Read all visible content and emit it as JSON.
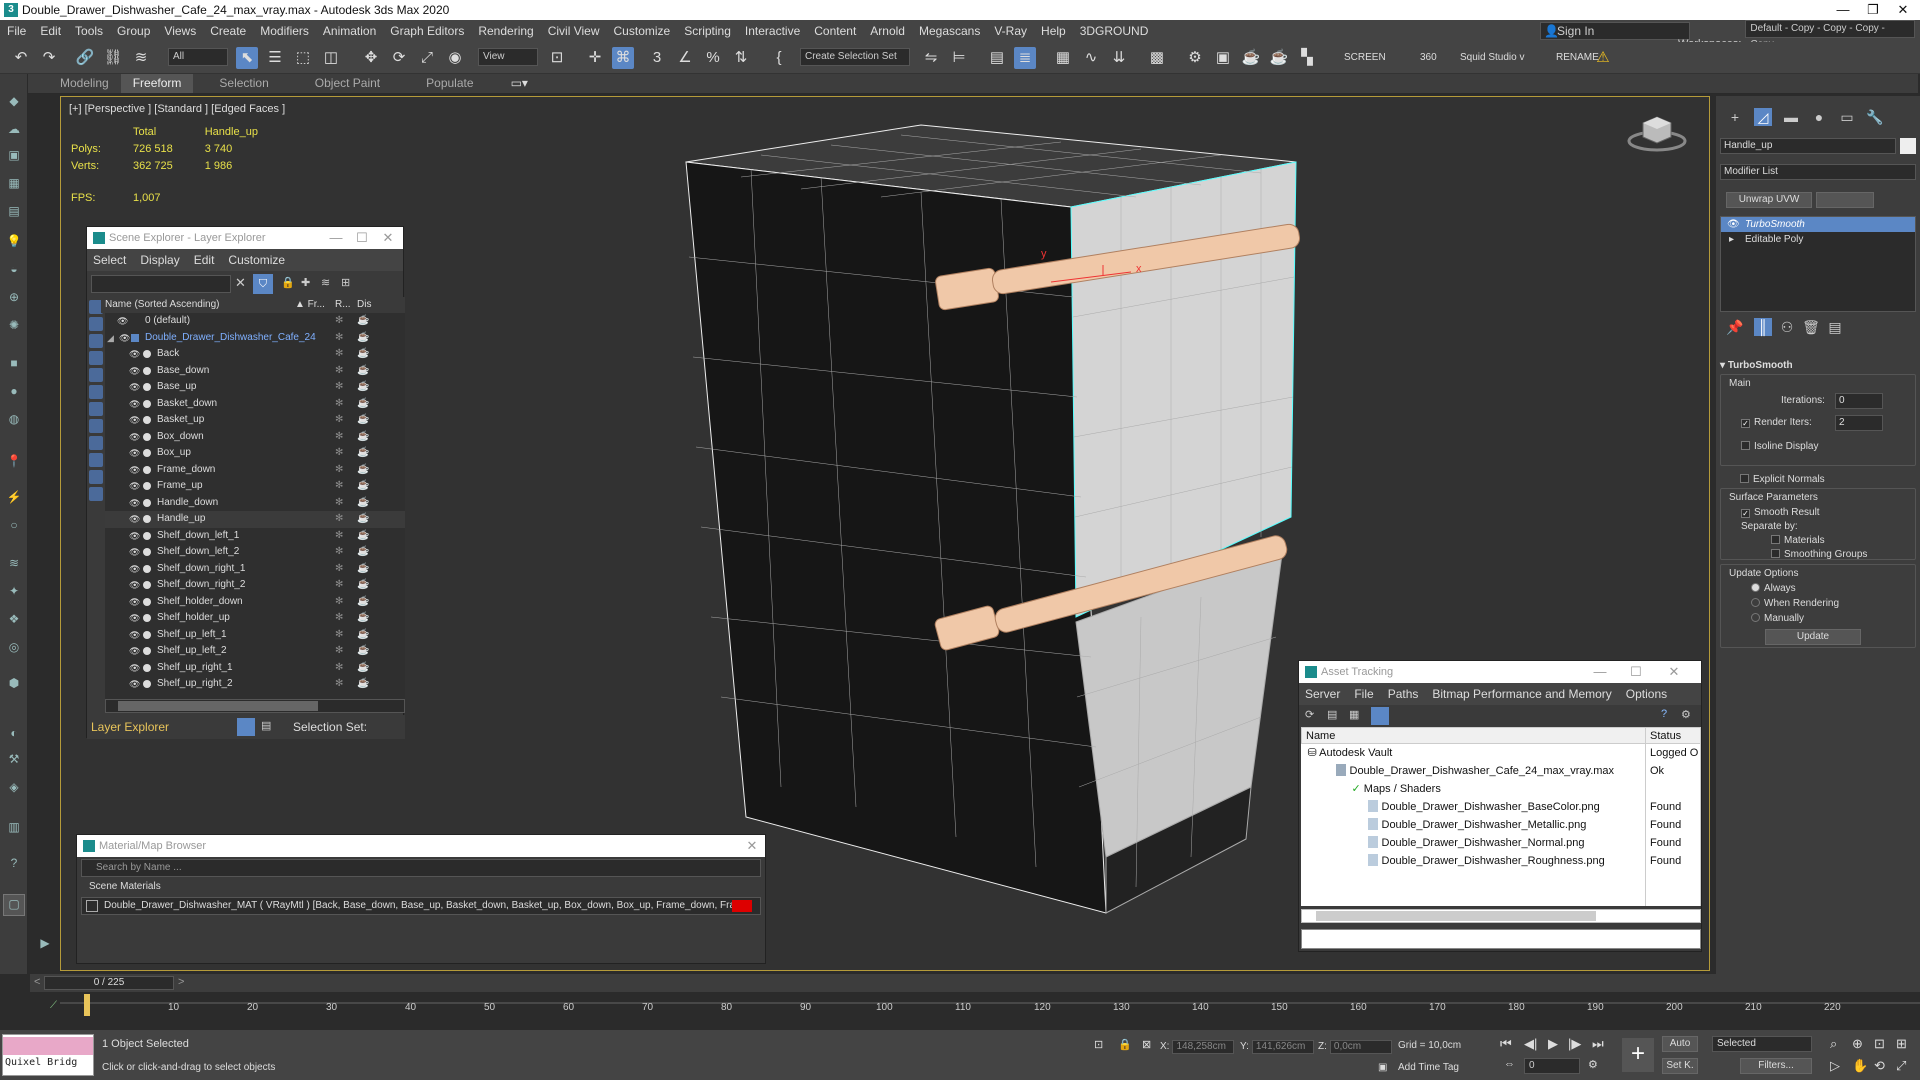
{
  "window": {
    "title": "Double_Drawer_Dishwasher_Cafe_24_max_vray.max - Autodesk 3ds Max 2020",
    "min": "—",
    "max": "❐",
    "close": "✕"
  },
  "menu": [
    "File",
    "Edit",
    "Tools",
    "Group",
    "Views",
    "Create",
    "Modifiers",
    "Animation",
    "Graph Editors",
    "Rendering",
    "Civil View",
    "Customize",
    "Scripting",
    "Interactive",
    "Content",
    "Arnold",
    "Megascans",
    "V-Ray",
    "Help",
    "3DGROUND"
  ],
  "signin": {
    "label": "Sign In"
  },
  "workspace": {
    "label": "Workspaces:",
    "value": "Default - Copy - Copy - Copy - Copy"
  },
  "toolbar": {
    "filter": "All",
    "refcoord": "View",
    "selset": "Create Selection Set",
    "screen": "SCREEN",
    "n360": "360",
    "squid": "Squid Studio v",
    "rename": "RENAME"
  },
  "ribbon": {
    "tabs": [
      "Modeling",
      "Freeform",
      "Selection",
      "Object Paint",
      "Populate"
    ]
  },
  "viewport": {
    "label": "[+] [Perspective ] [Standard ] [Edged Faces ]",
    "stats": {
      "hdr_total": "Total",
      "hdr_obj": "Handle_up",
      "polys_label": "Polys:",
      "polys_total": "726 518",
      "polys_obj": "3 740",
      "verts_label": "Verts:",
      "verts_total": "362 725",
      "verts_obj": "1 986",
      "fps_label": "FPS:",
      "fps": "1,007"
    },
    "axis_x": "x",
    "axis_y": "y"
  },
  "scene_explorer": {
    "title": "Scene Explorer - Layer Explorer",
    "menu": [
      "Select",
      "Display",
      "Edit",
      "Customize"
    ],
    "col_name": "Name (Sorted Ascending)",
    "col_fr": "▲ Fr...",
    "col_r": "R...",
    "col_dis": "Dis",
    "rows": [
      "0 (default)",
      "Double_Drawer_Dishwasher_Cafe_24",
      "Back",
      "Base_down",
      "Base_up",
      "Basket_down",
      "Basket_up",
      "Box_down",
      "Box_up",
      "Frame_down",
      "Frame_up",
      "Handle_down",
      "Handle_up",
      "Shelf_down_left_1",
      "Shelf_down_left_2",
      "Shelf_down_right_1",
      "Shelf_down_right_2",
      "Shelf_holder_down",
      "Shelf_holder_up",
      "Shelf_up_left_1",
      "Shelf_up_left_2",
      "Shelf_up_right_1",
      "Shelf_up_right_2"
    ],
    "selected_row": "Handle_up",
    "footer": "Layer Explorer",
    "selection_set": "Selection Set:"
  },
  "material_browser": {
    "title": "Material/Map Browser",
    "search": "Search by Name ...",
    "section": "Scene Materials",
    "material": "Double_Drawer_Dishwasher_MAT  ( VRayMtl )  [Back, Base_down, Base_up, Basket_down, Basket_up, Box_down, Box_up, Frame_down, Fra..."
  },
  "asset_tracking": {
    "title": "Asset Tracking",
    "menu": [
      "Server",
      "File",
      "Paths",
      "Bitmap Performance and Memory",
      "Options"
    ],
    "col_name": "Name",
    "col_status": "Status",
    "rows": [
      {
        "name": "Autodesk Vault",
        "status": "Logged O"
      },
      {
        "name": "Double_Drawer_Dishwasher_Cafe_24_max_vray.max",
        "status": "Ok"
      },
      {
        "name": "Maps / Shaders",
        "status": ""
      },
      {
        "name": "Double_Drawer_Dishwasher_BaseColor.png",
        "status": "Found"
      },
      {
        "name": "Double_Drawer_Dishwasher_Metallic.png",
        "status": "Found"
      },
      {
        "name": "Double_Drawer_Dishwasher_Normal.png",
        "status": "Found"
      },
      {
        "name": "Double_Drawer_Dishwasher_Roughness.png",
        "status": "Found"
      }
    ]
  },
  "command_panel": {
    "object_name": "Handle_up",
    "modifier_list": "Modifier List",
    "unwrap": "Unwrap UVW",
    "stack": [
      "TurboSmooth",
      "Editable Poly"
    ],
    "turbosmooth": "TurboSmooth",
    "main": "Main",
    "iterations_label": "Iterations:",
    "iterations": "0",
    "render_iters_label": "Render Iters:",
    "render_iters": "2",
    "isoline": "Isoline Display",
    "explicit": "Explicit Normals",
    "surface": "Surface Parameters",
    "smooth_result": "Smooth Result",
    "separate": "Separate by:",
    "materials": "Materials",
    "smoothing_groups": "Smoothing Groups",
    "update_options": "Update Options",
    "always": "Always",
    "when_rendering": "When Rendering",
    "manually": "Manually",
    "update": "Update"
  },
  "timeline": {
    "frame": "0 / 225",
    "ticks": [
      "0",
      "10",
      "20",
      "30",
      "40",
      "50",
      "60",
      "70",
      "80",
      "90",
      "100",
      "110",
      "120",
      "130",
      "140",
      "150",
      "160",
      "170",
      "180",
      "190",
      "200",
      "210",
      "220"
    ]
  },
  "status": {
    "quixel": "Quixel Bridg",
    "selected": "1 Object Selected",
    "prompt": "Click or click-and-drag to select objects",
    "x_label": "X:",
    "x": "148,258cm",
    "y_label": "Y:",
    "y": "141,626cm",
    "z_label": "Z:",
    "z": "0,0cm",
    "grid": "Grid = 10,0cm",
    "add_time_tag": "Add Time Tag",
    "auto": "Auto",
    "setk": "Set K.",
    "sel_filter": "Selected",
    "filters": "Filters...",
    "frame_field": "0"
  }
}
